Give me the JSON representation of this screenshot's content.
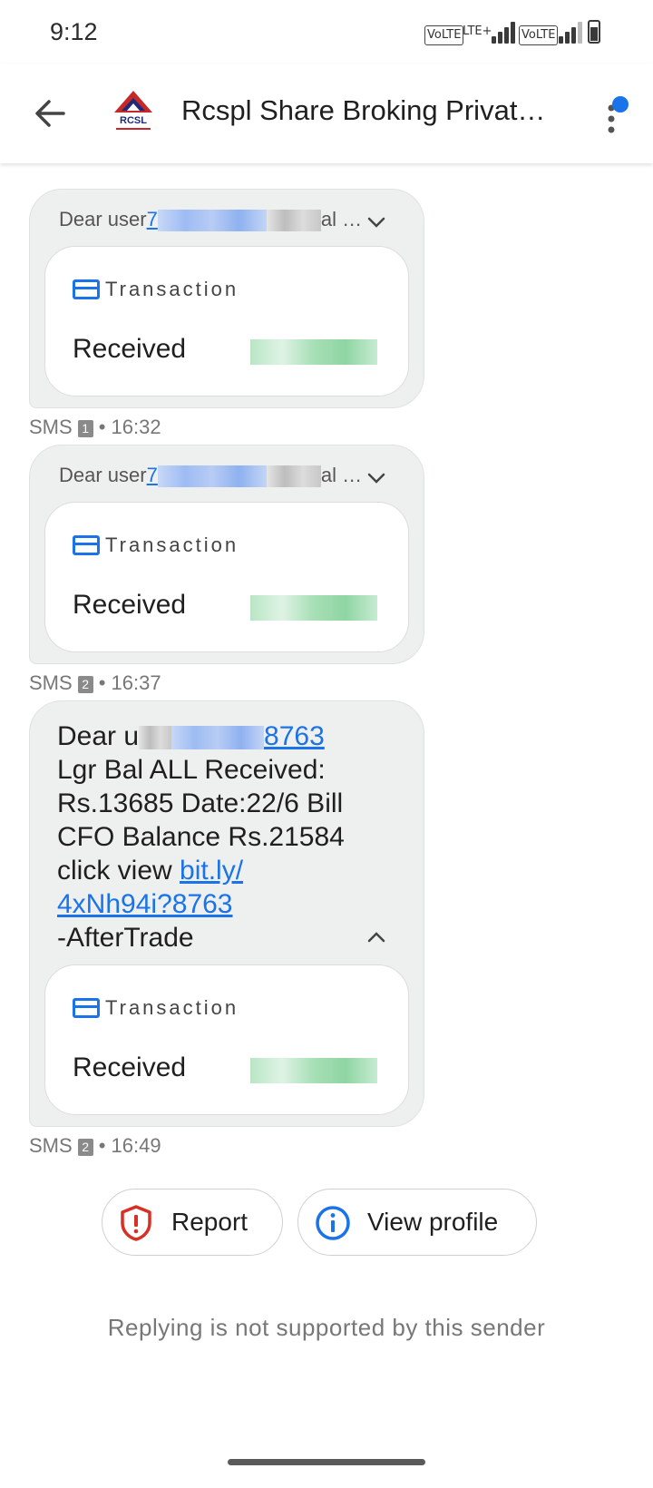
{
  "status_bar": {
    "time": "9:12",
    "volte_1": "VoLTE",
    "lte": "LTE+",
    "volte_2": "VoLTE"
  },
  "app_bar": {
    "title": "Rcspl Share Broking Privat…",
    "logo_text": "RCSL",
    "back_icon": "arrow-left-icon",
    "more_icon": "more-vertical-icon"
  },
  "messages": [
    {
      "header_prefix": "Dear user",
      "header_link_start": "7",
      "header_suffix": "al …",
      "card": {
        "label": "Transaction",
        "status": "Received"
      },
      "meta": {
        "channel": "SMS",
        "sim": "1",
        "time": "• 16:32"
      }
    },
    {
      "header_prefix": "Dear user",
      "header_link_start": "7",
      "header_suffix": "al …",
      "card": {
        "label": "Transaction",
        "status": "Received"
      },
      "meta": {
        "channel": "SMS",
        "sim": "2",
        "time": "• 16:37"
      }
    },
    {
      "line1_prefix": "Dear u",
      "line1_link_end": "8763",
      "line2": "Lgr Bal ALL Received:",
      "line3": "Rs.13685 Date:22/6 Bill",
      "line4": "CFO Balance Rs.21584",
      "line5_prefix": "click view ",
      "link_part1": "bit.ly/",
      "link_part2": "4xNh94i?8763",
      "line7": "-AfterTrade",
      "card": {
        "label": "Transaction",
        "status": "Received"
      },
      "meta": {
        "channel": "SMS",
        "sim": "2",
        "time": "• 16:49"
      }
    }
  ],
  "actions": {
    "report": "Report",
    "view_profile": "View profile"
  },
  "footer_note": "Replying is not supported by this sender",
  "colors": {
    "accent": "#1a73e8",
    "report_red": "#d93025",
    "bubble": "#eef0ef"
  }
}
